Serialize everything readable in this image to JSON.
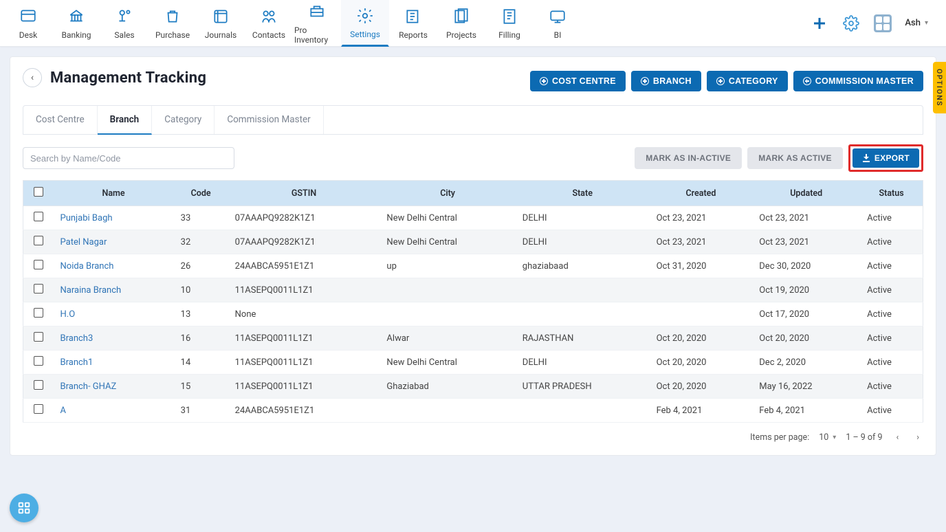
{
  "nav": {
    "items": [
      {
        "label": "Desk"
      },
      {
        "label": "Banking"
      },
      {
        "label": "Sales"
      },
      {
        "label": "Purchase"
      },
      {
        "label": "Journals"
      },
      {
        "label": "Contacts"
      },
      {
        "label": "Pro Inventory"
      },
      {
        "label": "Settings"
      },
      {
        "label": "Reports"
      },
      {
        "label": "Projects"
      },
      {
        "label": "Filling"
      },
      {
        "label": "BI"
      }
    ],
    "active_index": 7,
    "user_name": "Ash"
  },
  "side_tab": "OPTIONS",
  "page": {
    "title": "Management Tracking",
    "action_buttons": [
      "COST CENTRE",
      "BRANCH",
      "CATEGORY",
      "COMMISSION MASTER"
    ]
  },
  "tabs": {
    "items": [
      "Cost Centre",
      "Branch",
      "Category",
      "Commission Master"
    ],
    "active_index": 1
  },
  "toolbar": {
    "search_placeholder": "Search by Name/Code",
    "inactive_label": "MARK AS IN-ACTIVE",
    "active_label": "MARK AS ACTIVE",
    "export_label": "EXPORT"
  },
  "table": {
    "columns": [
      "Name",
      "Code",
      "GSTIN",
      "City",
      "State",
      "Created",
      "Updated",
      "Status"
    ],
    "rows": [
      {
        "name": "Punjabi Bagh",
        "code": "33",
        "gstin": "07AAAPQ9282K1Z1",
        "city": "New Delhi Central",
        "state": "DELHI",
        "created": "Oct 23, 2021",
        "updated": "Oct 23, 2021",
        "status": "Active"
      },
      {
        "name": "Patel Nagar",
        "code": "32",
        "gstin": "07AAAPQ9282K1Z1",
        "city": "New Delhi Central",
        "state": "DELHI",
        "created": "Oct 23, 2021",
        "updated": "Oct 23, 2021",
        "status": "Active"
      },
      {
        "name": "Noida Branch",
        "code": "26",
        "gstin": "24AABCA5951E1Z1",
        "city": "up",
        "state": "ghaziabaad",
        "created": "Oct 31, 2020",
        "updated": "Dec 30, 2020",
        "status": "Active"
      },
      {
        "name": "Naraina Branch",
        "code": "10",
        "gstin": "11ASEPQ0011L1Z1",
        "city": "",
        "state": "",
        "created": "",
        "updated": "Oct 19, 2020",
        "status": "Active"
      },
      {
        "name": "H.O",
        "code": "13",
        "gstin": "None",
        "city": "",
        "state": "",
        "created": "",
        "updated": "Oct 17, 2020",
        "status": "Active"
      },
      {
        "name": "Branch3",
        "code": "16",
        "gstin": "11ASEPQ0011L1Z1",
        "city": "Alwar",
        "state": "RAJASTHAN",
        "created": "Oct 20, 2020",
        "updated": "Oct 20, 2020",
        "status": "Active"
      },
      {
        "name": "Branch1",
        "code": "14",
        "gstin": "11ASEPQ0011L1Z1",
        "city": "New Delhi Central",
        "state": "DELHI",
        "created": "Oct 20, 2020",
        "updated": "Dec 2, 2020",
        "status": "Active"
      },
      {
        "name": "Branch- GHAZ",
        "code": "15",
        "gstin": "11ASEPQ0011L1Z1",
        "city": "Ghaziabad",
        "state": "UTTAR PRADESH",
        "created": "Oct 20, 2020",
        "updated": "May 16, 2022",
        "status": "Active"
      },
      {
        "name": "A",
        "code": "31",
        "gstin": "24AABCA5951E1Z1",
        "city": "",
        "state": "",
        "created": "Feb 4, 2021",
        "updated": "Feb 4, 2021",
        "status": "Active"
      }
    ]
  },
  "pagination": {
    "label": "Items per page:",
    "size": "10",
    "range": "1 – 9 of 9"
  }
}
